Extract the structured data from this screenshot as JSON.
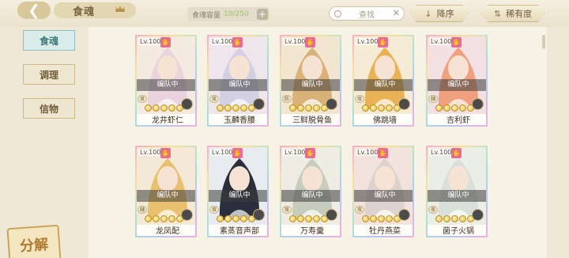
{
  "header": {
    "back_icon": "back-arrow-icon",
    "title": "食魂",
    "title_icon": "crown-icon",
    "capacity_label": "食魂容量",
    "capacity_value": "10/250",
    "capacity_add": "+",
    "search_placeholder": "查找",
    "search_clear": "✕",
    "sort_order_label": "降序",
    "sort_order_icon": "↓",
    "sort_by_label": "稀有度",
    "sort_by_icon": "⇅"
  },
  "sidebar": {
    "tabs": [
      {
        "label": "食魂",
        "active": true
      },
      {
        "label": "调理",
        "active": false
      },
      {
        "label": "信物",
        "active": false
      }
    ],
    "decompose_label": "分解"
  },
  "cards": [
    {
      "level": "Lv.100",
      "status": "编队中",
      "badge": "攻",
      "name": "龙井虾仁",
      "stars": 5,
      "bg": "#f4eadf",
      "hair": "#e9d3df"
    },
    {
      "level": "Lv.100",
      "status": "编队中",
      "badge": "攻",
      "name": "玉麟香腰",
      "stars": 5,
      "bg": "#eee6ea",
      "hair": "#d4d0e4"
    },
    {
      "level": "Lv.100",
      "status": "编队中",
      "badge": "防",
      "name": "三鲜脱骨鱼",
      "stars": 5,
      "bg": "#f3e6d0",
      "hair": "#d9b27a"
    },
    {
      "level": "Lv.100",
      "status": "编队中",
      "badge": "攻",
      "name": "佛跳墙",
      "stars": 5,
      "bg": "#f6ecd5",
      "hair": "#e8b255"
    },
    {
      "level": "Lv.100",
      "status": "编队中",
      "badge": "辅",
      "name": "吉利虾",
      "stars": 5,
      "bg": "#f2e0e3",
      "hair": "#f0a07f"
    },
    {
      "level": "Lv.100",
      "status": "编队中",
      "badge": "辅",
      "name": "龙凤配",
      "stars": 5,
      "bg": "#f3e9d6",
      "hair": "#e9c06e"
    },
    {
      "level": "Lv.100",
      "status": "编队中",
      "badge": "攻",
      "name": "素蒸音声部",
      "stars": 5,
      "bg": "#e8ebef",
      "hair": "#2b2f3d"
    },
    {
      "level": "Lv.100",
      "status": "编队中",
      "badge": "攻",
      "name": "万寿羹",
      "stars": 5,
      "bg": "#efece3",
      "hair": "#c8ccbf"
    },
    {
      "level": "Lv.100",
      "status": "编队中",
      "badge": "攻",
      "name": "牡丹燕菜",
      "stars": 5,
      "bg": "#f2e3dc",
      "hair": "#ddd2cf"
    },
    {
      "level": "Lv.100",
      "status": "编队中",
      "badge": "攻",
      "name": "菌子火锅",
      "stars": 5,
      "bg": "#ebeee6",
      "hair": "#d9e0da"
    }
  ]
}
